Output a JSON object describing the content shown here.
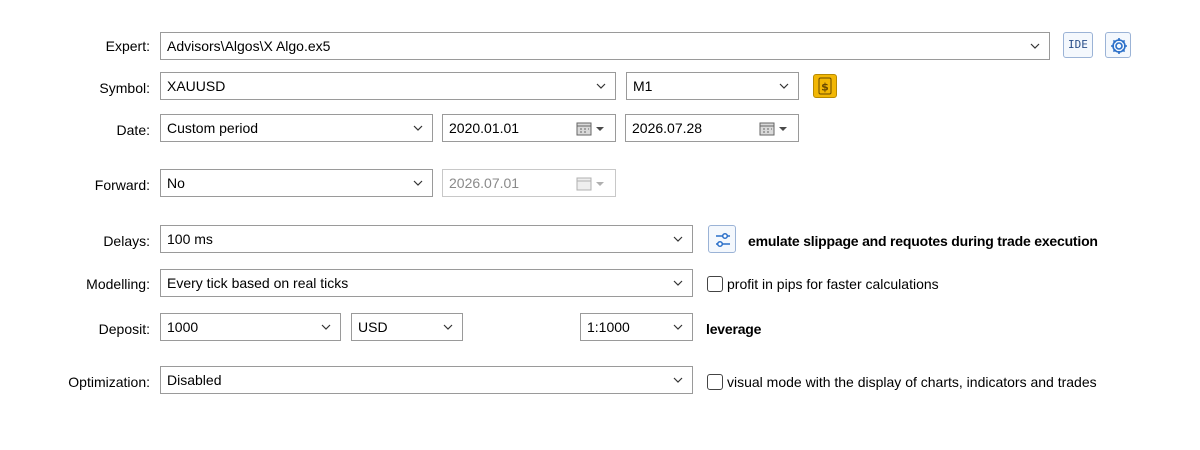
{
  "labels": {
    "expert": "Expert:",
    "symbol": "Symbol:",
    "date": "Date:",
    "forward": "Forward:",
    "delays": "Delays:",
    "modelling": "Modelling:",
    "deposit": "Deposit:",
    "optimization": "Optimization:"
  },
  "expert": {
    "value": "Advisors\\Algos\\X Algo.ex5",
    "ide_label": "IDE",
    "settings_icon": "gear-icon"
  },
  "symbol": {
    "value": "XAUUSD",
    "timeframe": "M1",
    "spec_icon": "dollar-icon"
  },
  "date": {
    "period": "Custom period",
    "from": "2020.01.01",
    "to": "2026.07.28"
  },
  "forward": {
    "value": "No",
    "date": "2026.07.01"
  },
  "delays": {
    "value": "100 ms",
    "settings_icon": "sliders-icon",
    "note": "emulate slippage and requotes during trade execution"
  },
  "modelling": {
    "value": "Every tick based on real ticks",
    "checkbox_label": "profit in pips for faster calculations",
    "checked": false
  },
  "deposit": {
    "amount": "1000",
    "currency": "USD",
    "leverage_value": "1:1000",
    "leverage_label": "leverage"
  },
  "optimization": {
    "value": "Disabled",
    "checkbox_label": "visual mode with the display of charts, indicators and trades",
    "checked": false
  },
  "colors": {
    "accent_icon": "#2a6fc9",
    "dollar_bg": "#f2b705",
    "border": "#9a9a9a"
  }
}
